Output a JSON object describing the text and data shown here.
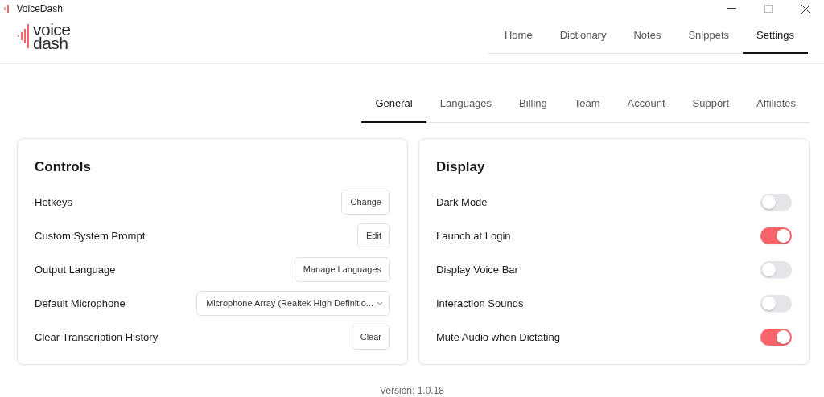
{
  "window": {
    "title": "VoiceDash"
  },
  "logo": {
    "line_1": "voice",
    "line_2": "dash"
  },
  "main_tabs": [
    {
      "label": "Home",
      "selected": false
    },
    {
      "label": "Dictionary",
      "selected": false
    },
    {
      "label": "Notes",
      "selected": false
    },
    {
      "label": "Snippets",
      "selected": false
    },
    {
      "label": "Settings",
      "selected": true
    }
  ],
  "settings_tabs": [
    {
      "label": "General",
      "selected": true
    },
    {
      "label": "Languages",
      "selected": false
    },
    {
      "label": "Billing",
      "selected": false
    },
    {
      "label": "Team",
      "selected": false
    },
    {
      "label": "Account",
      "selected": false
    },
    {
      "label": "Support",
      "selected": false
    },
    {
      "label": "Affiliates",
      "selected": false
    }
  ],
  "controls": {
    "title": "Controls",
    "rows": [
      {
        "label": "Hotkeys",
        "kind": "button",
        "action": "Change"
      },
      {
        "label": "Custom System Prompt",
        "kind": "button",
        "action": "Edit"
      },
      {
        "label": "Output Language",
        "kind": "button",
        "action": "Manage Languages"
      },
      {
        "label": "Default Microphone",
        "kind": "select",
        "value": "Microphone Array (Realtek High Definitio..."
      },
      {
        "label": "Clear Transcription History",
        "kind": "button",
        "action": "Clear"
      }
    ]
  },
  "display": {
    "title": "Display",
    "rows": [
      {
        "label": "Dark Mode",
        "on": false
      },
      {
        "label": "Launch at Login",
        "on": true
      },
      {
        "label": "Display Voice Bar",
        "on": false
      },
      {
        "label": "Interaction Sounds",
        "on": false
      },
      {
        "label": "Mute Audio when Dictating",
        "on": true
      }
    ]
  },
  "version": "Version: 1.0.18"
}
